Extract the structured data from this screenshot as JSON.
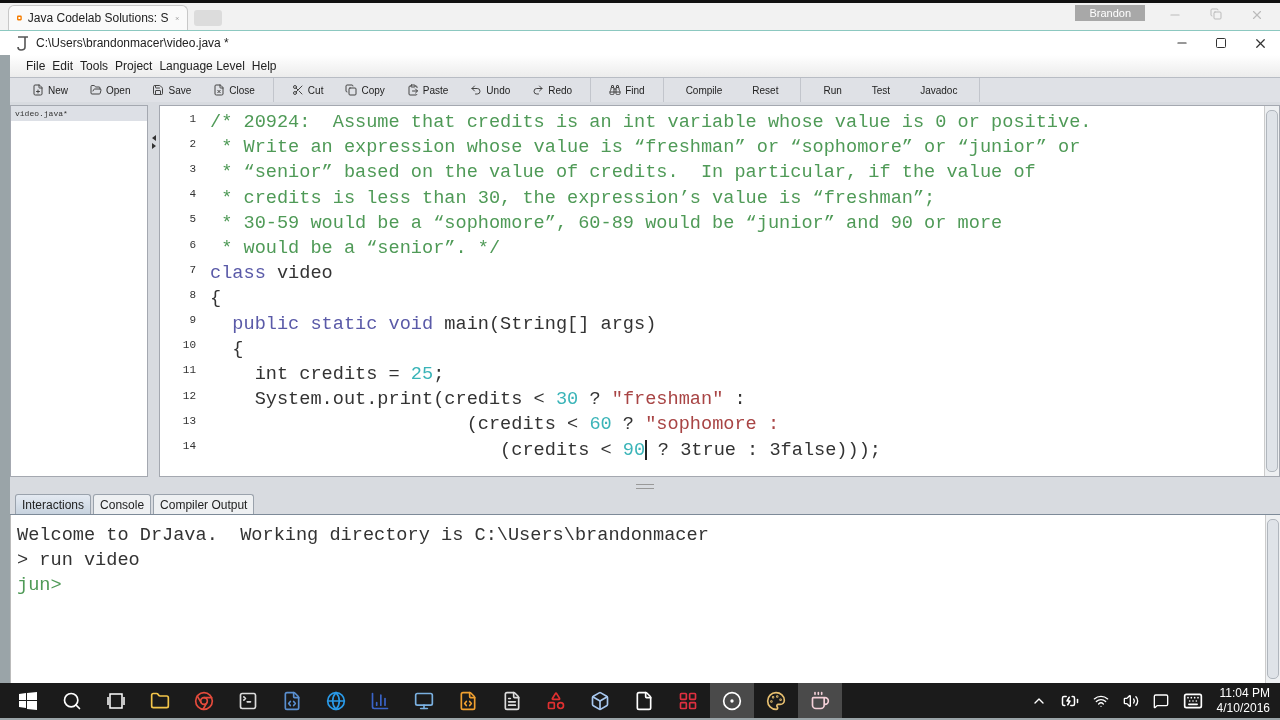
{
  "browser": {
    "tab_title": "Java Codelab Solutions: S",
    "profile": "Brandon"
  },
  "window": {
    "title": "C:\\Users\\brandonmacer\\video.java *"
  },
  "menu": [
    "File",
    "Edit",
    "Tools",
    "Project",
    "Language Level",
    "Help"
  ],
  "toolbar": [
    [
      {
        "label": "New",
        "kind": "new"
      },
      {
        "label": "Open",
        "kind": "open"
      },
      {
        "label": "Save",
        "kind": "save"
      },
      {
        "label": "Close",
        "kind": "close"
      }
    ],
    [
      {
        "label": "Cut",
        "kind": "cut"
      },
      {
        "label": "Copy",
        "kind": "copy"
      },
      {
        "label": "Paste",
        "kind": "paste"
      },
      {
        "label": "Undo",
        "kind": "undo"
      },
      {
        "label": "Redo",
        "kind": "redo"
      }
    ],
    [
      {
        "label": "Find",
        "kind": "find"
      }
    ],
    [
      {
        "label": "Compile",
        "kind": "text"
      },
      {
        "label": "Reset",
        "kind": "text"
      }
    ],
    [
      {
        "label": "Run",
        "kind": "text"
      },
      {
        "label": "Test",
        "kind": "text"
      },
      {
        "label": "Javadoc",
        "kind": "text"
      }
    ]
  ],
  "files": [
    {
      "name": "video.java*",
      "selected": true
    }
  ],
  "editor": {
    "lines": [
      {
        "number": "1",
        "tokens": [
          {
            "kind": "comment",
            "text": "/* 20924:  Assume that credits is an int variable whose value is 0 or positive."
          }
        ]
      },
      {
        "number": "2",
        "tokens": [
          {
            "kind": "comment",
            "text": " * Write an expression whose value is “freshman” or “sophomore” or “junior” or"
          }
        ]
      },
      {
        "number": "3",
        "tokens": [
          {
            "kind": "comment",
            "text": " * “senior” based on the value of credits.  In particular, if the value of"
          }
        ]
      },
      {
        "number": "4",
        "tokens": [
          {
            "kind": "comment",
            "text": " * credits is less than 30, the expression’s value is “freshman”;"
          }
        ]
      },
      {
        "number": "5",
        "tokens": [
          {
            "kind": "comment",
            "text": " * 30-59 would be a “sophomore”, 60-89 would be “junior” and 90 or more"
          }
        ]
      },
      {
        "number": "6",
        "tokens": [
          {
            "kind": "comment",
            "text": " * would be a “senior”. */"
          }
        ]
      },
      {
        "number": "7",
        "tokens": [
          {
            "kind": "keyword",
            "text": "class"
          },
          {
            "kind": "plain",
            "text": " video"
          }
        ]
      },
      {
        "number": "8",
        "tokens": [
          {
            "kind": "plain",
            "text": "{"
          }
        ]
      },
      {
        "number": "9",
        "tokens": [
          {
            "kind": "keyword",
            "text": "  public static void"
          },
          {
            "kind": "plain",
            "text": " main(String[] args)"
          }
        ]
      },
      {
        "number": "10",
        "tokens": [
          {
            "kind": "plain",
            "text": "  {"
          }
        ]
      },
      {
        "number": "11",
        "tokens": [
          {
            "kind": "plain",
            "text": "    int credits = "
          },
          {
            "kind": "number",
            "text": "25"
          },
          {
            "kind": "plain",
            "text": ";"
          }
        ]
      },
      {
        "number": "12",
        "tokens": [
          {
            "kind": "plain",
            "text": "    System.out.print(credits < "
          },
          {
            "kind": "number",
            "text": "30"
          },
          {
            "kind": "plain",
            "text": " ? "
          },
          {
            "kind": "string",
            "text": "\"freshman\""
          },
          {
            "kind": "plain",
            "text": " :"
          }
        ]
      },
      {
        "number": "13",
        "tokens": [
          {
            "kind": "plain",
            "text": "                       (credits < "
          },
          {
            "kind": "number",
            "text": "60"
          },
          {
            "kind": "plain",
            "text": " ? "
          },
          {
            "kind": "string",
            "text": "\"sophomore :"
          }
        ]
      },
      {
        "number": "14",
        "tokens": [
          {
            "kind": "plain",
            "text": "                          (credits < "
          },
          {
            "kind": "number",
            "text": "90",
            "caret": true
          },
          {
            "kind": "plain",
            "text": " ? 3true : 3false)));"
          }
        ]
      }
    ]
  },
  "bottom_tabs": [
    {
      "label": "Interactions",
      "selected": true
    },
    {
      "label": "Console",
      "selected": false
    },
    {
      "label": "Compiler Output",
      "selected": false
    }
  ],
  "console": {
    "lines": [
      {
        "kind": "output",
        "text": "Welcome to DrJava.  Working directory is C:\\Users\\brandonmacer"
      },
      {
        "kind": "output",
        "text": "> run video"
      },
      {
        "kind": "input",
        "text": "jun>"
      }
    ]
  },
  "taskbar": {
    "apps": [
      {
        "kind": "start",
        "active": false
      },
      {
        "kind": "search",
        "active": false
      },
      {
        "kind": "taskview",
        "active": false
      },
      {
        "kind": "folder",
        "active": false
      },
      {
        "kind": "browser",
        "active": false
      },
      {
        "kind": "terminal",
        "active": false
      },
      {
        "kind": "script",
        "active": false
      },
      {
        "kind": "globe",
        "active": false
      },
      {
        "kind": "chart",
        "active": false
      },
      {
        "kind": "monitor",
        "active": false
      },
      {
        "kind": "editor",
        "active": false
      },
      {
        "kind": "document-text",
        "active": false
      },
      {
        "kind": "shapes",
        "active": false
      },
      {
        "kind": "cube",
        "active": false
      },
      {
        "kind": "document",
        "active": false
      },
      {
        "kind": "dots",
        "active": false
      },
      {
        "kind": "record",
        "active": true
      },
      {
        "kind": "palette",
        "active": false
      },
      {
        "kind": "ide",
        "active": true
      }
    ],
    "time": "11:04 PM",
    "date": "4/10/2016"
  }
}
